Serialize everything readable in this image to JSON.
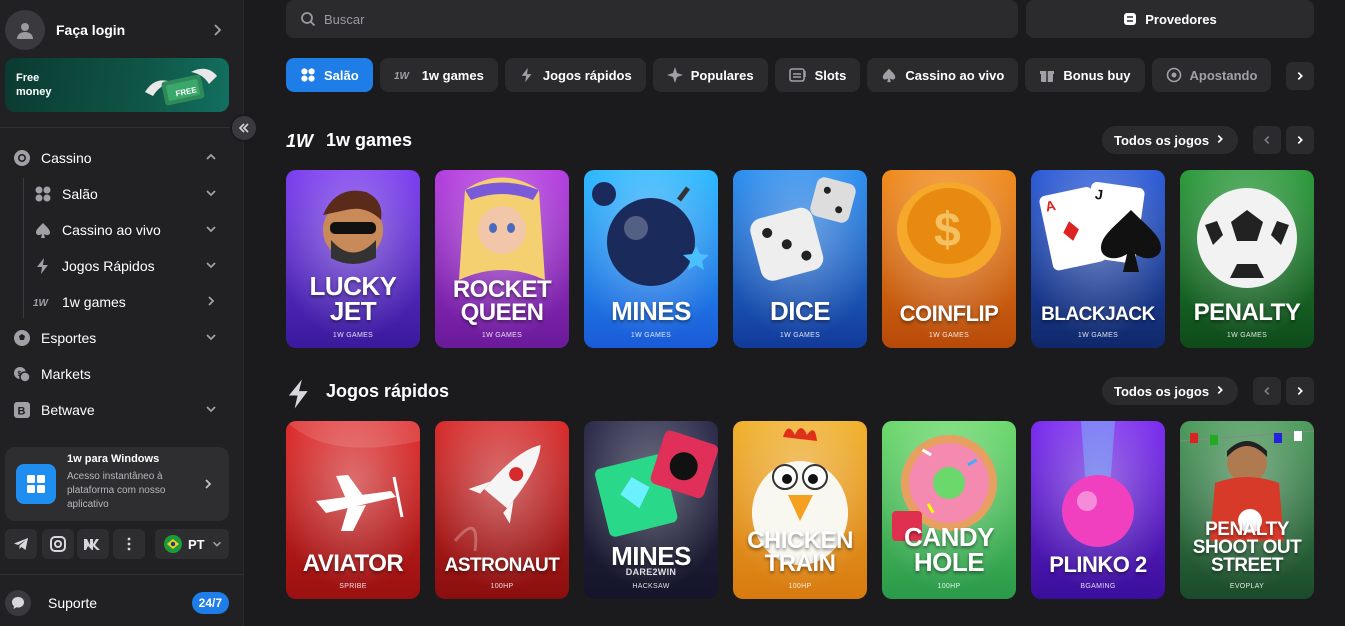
{
  "sidebar": {
    "login_label": "Faça login",
    "promo_label": "Free money",
    "promo_badge": "FREE",
    "nav": [
      {
        "label": "Cassino",
        "icon": "casino-chip-icon"
      },
      {
        "label": "Salão",
        "icon": "grid-icon"
      },
      {
        "label": "Cassino ao vivo",
        "icon": "spade-icon"
      },
      {
        "label": "Jogos Rápidos",
        "icon": "lightning-icon"
      },
      {
        "label": "1w games",
        "icon": "1w-logo-icon"
      },
      {
        "label": "Esportes",
        "icon": "soccer-ball-icon"
      },
      {
        "label": "Markets",
        "icon": "coins-icon"
      },
      {
        "label": "Betwave",
        "icon": "betwave-icon"
      }
    ],
    "windows_card": {
      "title": "1w para Windows",
      "description": "Acesso instantâneo à plataforma com nosso aplicativo"
    },
    "language": "PT",
    "support_label": "Suporte",
    "support_badge": "24/7"
  },
  "header": {
    "search_placeholder": "Buscar",
    "providers_label": "Provedores"
  },
  "tabs": [
    {
      "label": "Salão",
      "icon": "grid-icon",
      "active": true
    },
    {
      "label": "1w games",
      "icon": "1w-logo-icon"
    },
    {
      "label": "Jogos rápidos",
      "icon": "lightning-icon"
    },
    {
      "label": "Populares",
      "icon": "sparkle-icon"
    },
    {
      "label": "Slots",
      "icon": "slot-machine-icon"
    },
    {
      "label": "Cassino ao vivo",
      "icon": "spade-icon"
    },
    {
      "label": "Bonus buy",
      "icon": "gift-icon"
    },
    {
      "label": "Apostando",
      "icon": "bet-icon"
    }
  ],
  "sections": [
    {
      "title": "1w games",
      "icon_text": "1W",
      "all_label": "Todos os jogos",
      "games": [
        {
          "title_lines": [
            "LUCKY",
            "JET"
          ],
          "provider": "1W GAMES",
          "colors": [
            "#7a3cf0",
            "#3a1a9c"
          ]
        },
        {
          "title_lines": [
            "ROCKET",
            "QUEEN"
          ],
          "provider": "1W GAMES",
          "colors": [
            "#b43ce0",
            "#6a1a9a"
          ]
        },
        {
          "title_lines": [
            "MINES"
          ],
          "provider": "1W GAMES",
          "colors": [
            "#2ab8ff",
            "#1a5ad8"
          ]
        },
        {
          "title_lines": [
            "DICE"
          ],
          "provider": "1W GAMES",
          "colors": [
            "#2a8ef0",
            "#123a9a"
          ]
        },
        {
          "title_lines": [
            "COINFLIP"
          ],
          "provider": "1W GAMES",
          "colors": [
            "#f08a1a",
            "#b84a0a"
          ]
        },
        {
          "title_lines": [
            "BLACKJACK"
          ],
          "provider": "1W GAMES",
          "colors": [
            "#2a5ad8",
            "#10286a"
          ]
        },
        {
          "title_lines": [
            "PENALTY"
          ],
          "provider": "1W GAMES",
          "colors": [
            "#2a9a3a",
            "#0e4a1a"
          ]
        }
      ]
    },
    {
      "title": "Jogos rápidos",
      "icon_text": "",
      "all_label": "Todos os jogos",
      "games": [
        {
          "title_lines": [
            "AVIATOR"
          ],
          "provider": "SPRIBE",
          "colors": [
            "#e02a2a",
            "#9a1010"
          ]
        },
        {
          "title_lines": [
            "ASTRONAUT"
          ],
          "provider": "100HP",
          "colors": [
            "#d82a2a",
            "#8a0e0e"
          ]
        },
        {
          "title_lines": [
            "MINES"
          ],
          "provider": "HACKSAW",
          "subtitle": "DARE2WIN",
          "colors": [
            "#2a2a4a",
            "#14142a"
          ]
        },
        {
          "title_lines": [
            "CHICKEN",
            "TRAIN"
          ],
          "provider": "100HP",
          "colors": [
            "#f0b02a",
            "#d87a10"
          ]
        },
        {
          "title_lines": [
            "CANDY",
            "HOLE"
          ],
          "provider": "100HP",
          "colors": [
            "#6ad86a",
            "#2a9a4a"
          ]
        },
        {
          "title_lines": [
            "PLINKO 2"
          ],
          "provider": "BGAMING",
          "colors": [
            "#7a2af0",
            "#3a0e9a"
          ]
        },
        {
          "title_lines": [
            "PENALTY",
            "SHOOT OUT",
            "STREET"
          ],
          "provider": "EVOPLAY",
          "colors": [
            "#4a9a5a",
            "#1a4a2a"
          ]
        }
      ]
    }
  ]
}
